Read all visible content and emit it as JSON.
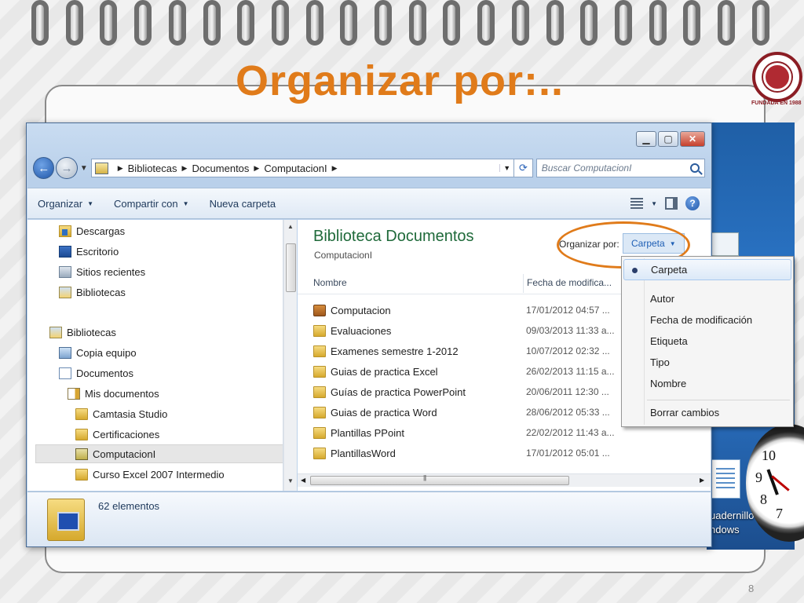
{
  "slide": {
    "title": "Organizar por:..",
    "logo_caption": "FUNDADA EN 1988",
    "page_number": "8"
  },
  "window": {
    "caption_buttons": [
      "minimize",
      "maximize",
      "close"
    ]
  },
  "address_bar": {
    "crumbs": [
      "Bibliotecas",
      "Documentos",
      "ComputacionI"
    ],
    "search_placeholder": "Buscar ComputacionI"
  },
  "toolbar": {
    "organize": "Organizar",
    "share": "Compartir con",
    "new_folder": "Nueva carpeta"
  },
  "nav_pane": {
    "items": [
      {
        "label": "Descargas",
        "icon": "downloads-folder-icon"
      },
      {
        "label": "Escritorio",
        "icon": "desktop-icon"
      },
      {
        "label": "Sitios recientes",
        "icon": "recent-places-icon"
      },
      {
        "label": "Bibliotecas",
        "icon": "libraries-icon"
      },
      {
        "label": "Bibliotecas",
        "icon": "libraries-icon"
      },
      {
        "label": "Copia equipo",
        "icon": "computer-icon"
      },
      {
        "label": "Documentos",
        "icon": "documents-icon"
      },
      {
        "label": "Mis documentos",
        "icon": "my-documents-icon"
      },
      {
        "label": "Camtasia Studio",
        "icon": "folder-icon"
      },
      {
        "label": "Certificaciones",
        "icon": "folder-icon"
      },
      {
        "label": "ComputacionI",
        "icon": "library-folder-icon",
        "selected": true
      },
      {
        "label": "Curso Excel 2007 Intermedio",
        "icon": "folder-icon"
      }
    ]
  },
  "content": {
    "library_title": "Biblioteca Documentos",
    "library_subtitle": "ComputacionI",
    "arrange_label": "Organizar por:",
    "arrange_value": "Carpeta",
    "columns": [
      "Nombre",
      "Fecha de modifica..."
    ],
    "files": [
      {
        "name": "Computacion",
        "date": "17/01/2012 04:57 ...",
        "icon": "briefcase-icon"
      },
      {
        "name": "Evaluaciones",
        "date": "09/03/2013 11:33 a...",
        "icon": "folder-icon"
      },
      {
        "name": "Examenes semestre 1-2012",
        "date": "10/07/2012 02:32 ...",
        "icon": "folder-icon"
      },
      {
        "name": "Guias de practica Excel",
        "date": "26/02/2013 11:15 a...",
        "icon": "folder-icon"
      },
      {
        "name": "Guías de practica PowerPoint",
        "date": "20/06/2011 12:30 ...",
        "icon": "folder-icon"
      },
      {
        "name": "Guias de practica Word",
        "date": "28/06/2012 05:33 ...",
        "icon": "folder-icon"
      },
      {
        "name": "Plantillas PPoint",
        "date": "22/02/2012 11:43 a...",
        "icon": "folder-icon"
      },
      {
        "name": "PlantillasWord",
        "date": "17/01/2012 05:01 ...",
        "icon": "folder-icon"
      }
    ]
  },
  "details": {
    "count": "62 elementos"
  },
  "arrange_menu": {
    "items": [
      "Carpeta",
      "Autor",
      "Fecha de modificación",
      "Etiqueta",
      "Tipo",
      "Nombre"
    ],
    "checked_index": 0,
    "reset": "Borrar cambios"
  },
  "desktop": {
    "shortcut_label_1": "uadernillo",
    "shortcut_label_2": "ndows",
    "clock_numbers": [
      "10",
      "9",
      "8",
      "7"
    ]
  },
  "colors": {
    "title_orange": "#e07b1a",
    "library_green": "#1f6a3a",
    "link_blue": "#1f5fb5"
  }
}
